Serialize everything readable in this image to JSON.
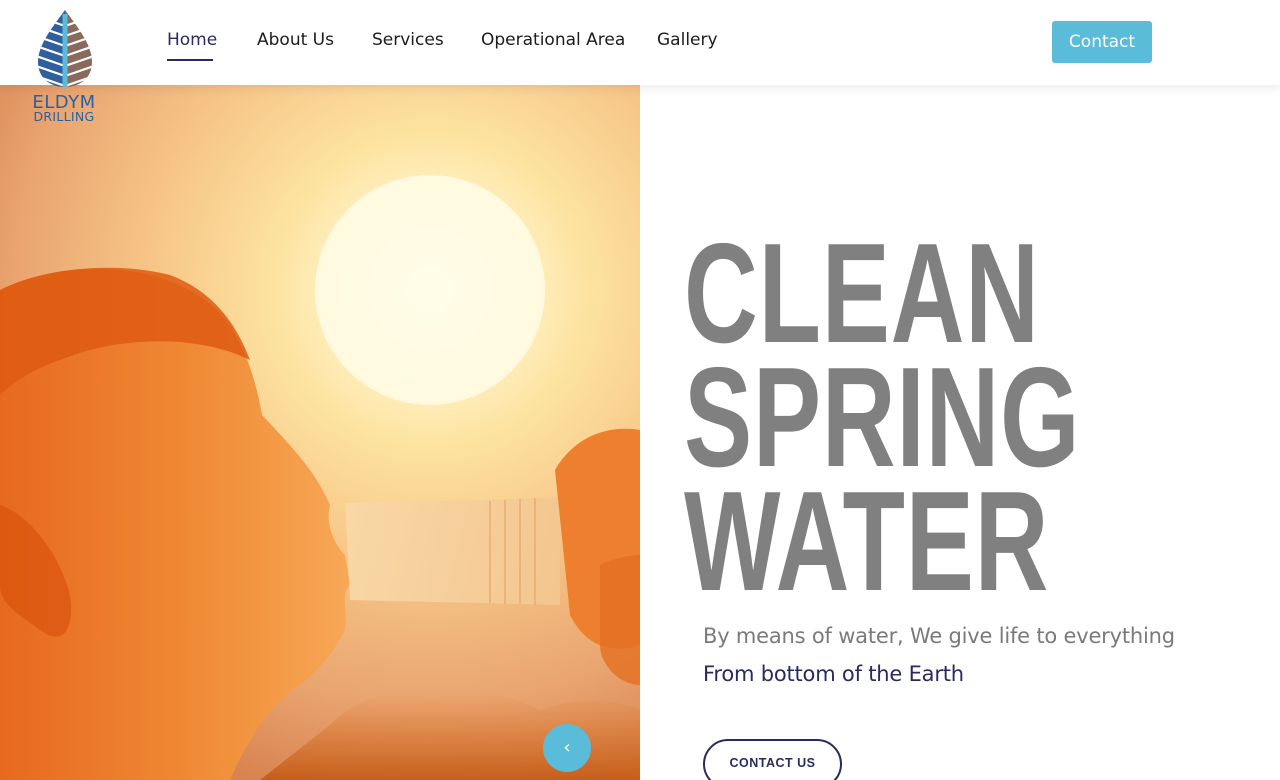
{
  "brand": {
    "name_line1": "ELDYM",
    "name_line2": "DRILLING",
    "logo_icon": "leaf-drop-icon",
    "colors": {
      "blue": "#2f5f9e",
      "brown": "#8a6a5c",
      "accent": "#5bbcd9",
      "navy": "#2a2a5e"
    }
  },
  "nav": {
    "items": [
      {
        "label": "Home",
        "active": true
      },
      {
        "label": "About Us",
        "active": false
      },
      {
        "label": "Services",
        "active": false
      },
      {
        "label": "Operational Area",
        "active": false
      },
      {
        "label": "Gallery",
        "active": false
      }
    ],
    "contact_label": "Contact"
  },
  "hero": {
    "headline": [
      "CLEAN",
      "SPRING",
      "WATER"
    ],
    "tagline": "By means of water, We give life to everything",
    "subline": "From bottom of the Earth",
    "cta_label": "CONTACT US",
    "prev_icon": "chevron-left-icon",
    "prev_symbol": "‹",
    "image_subject": "person-drinking-water-bottle-sunset-image"
  }
}
